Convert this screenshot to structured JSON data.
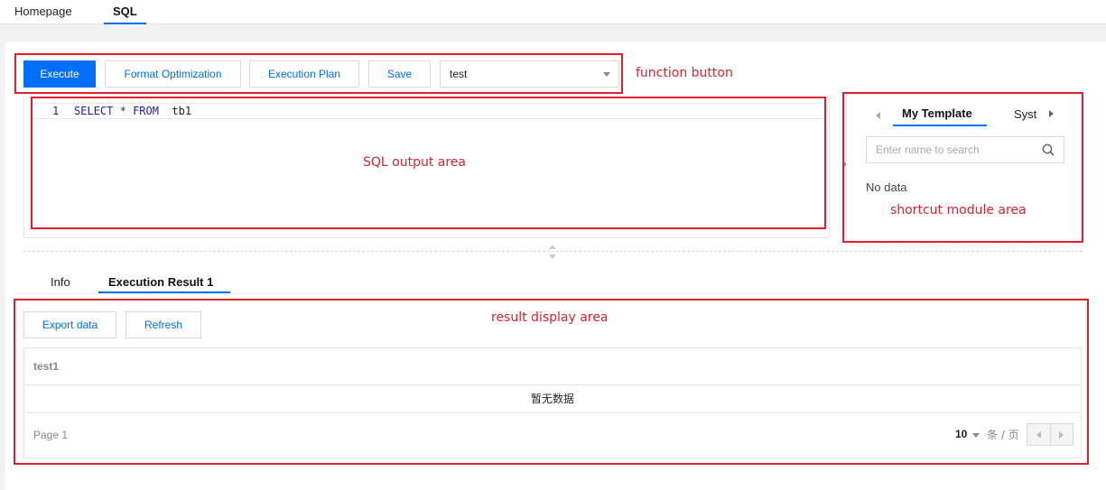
{
  "top_tabs": {
    "home": "Homepage",
    "sql": "SQL"
  },
  "toolbar": {
    "execute": "Execute",
    "format": "Format Optimization",
    "plan": "Execution Plan",
    "save": "Save",
    "db_select": "test"
  },
  "editor": {
    "line_number": "1",
    "kw_select": "SELECT",
    "star": "*",
    "kw_from": "FROM",
    "table": "tb1"
  },
  "side": {
    "tab_active": "My Template",
    "tab_other": "Syst",
    "search_placeholder": "Enter name to search",
    "no_data": "No data"
  },
  "result_tabs": {
    "info": "Info",
    "exec": "Execution Result 1"
  },
  "result": {
    "export": "Export data",
    "refresh": "Refresh",
    "column": "test1",
    "empty_text": "暂无数据",
    "page": "Page 1",
    "page_size": "10",
    "page_unit": "条 / 页"
  },
  "annotations": {
    "function_button": "function button",
    "sql_output": "SQL output area",
    "shortcut": "shortcut module area",
    "result_display": "result display area"
  },
  "colors": {
    "primary": "#006eff",
    "annotation": "#e0202e"
  }
}
